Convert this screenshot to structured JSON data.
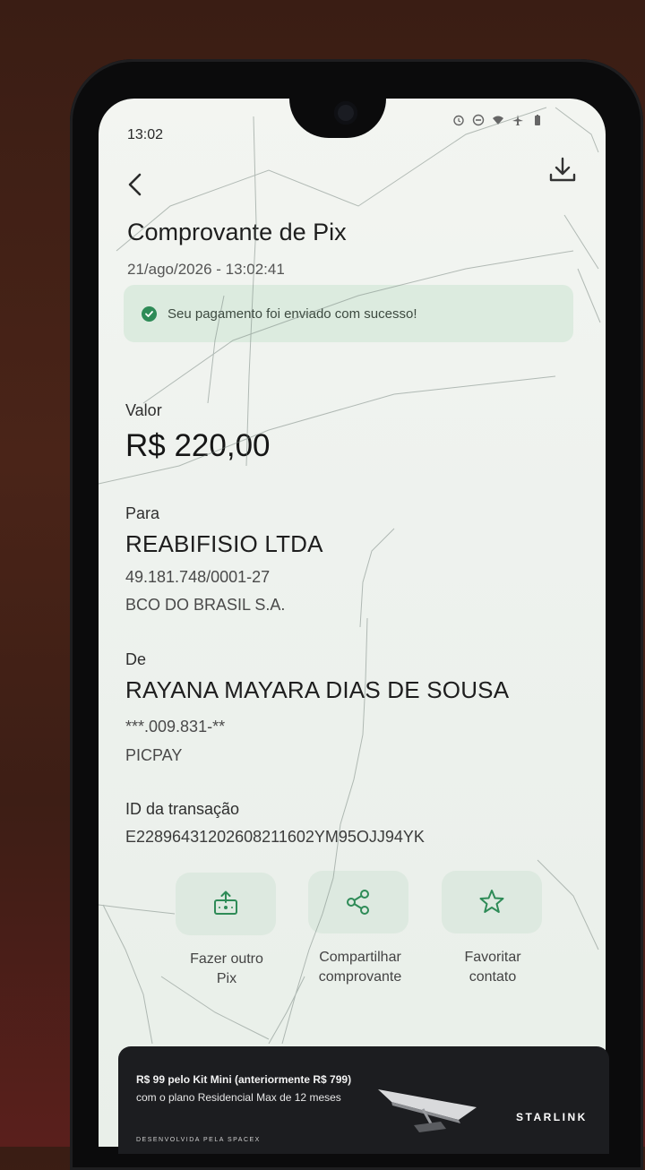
{
  "status_bar": {
    "time": "13:02"
  },
  "header": {
    "title": "Comprovante de Pix",
    "datetime": "21/ago/2026 - 13:02:41"
  },
  "banner": {
    "text": "Seu pagamento foi enviado com sucesso!"
  },
  "amount": {
    "label": "Valor",
    "value": "R$ 220,00"
  },
  "recipient": {
    "label": "Para",
    "name": "REABIFISIO LTDA",
    "document": "49.181.748/0001-27",
    "bank": "BCO DO BRASIL S.A."
  },
  "sender": {
    "label": "De",
    "name": "RAYANA MAYARA DIAS DE SOUSA",
    "document": "***.009.831-**",
    "bank": "PICPAY"
  },
  "transaction": {
    "label": "ID da transação",
    "id": "E22896431202608211602YM95OJJ94YK"
  },
  "actions": [
    {
      "line1": "Fazer outro",
      "line2": "Pix",
      "icon": "pix-transfer-icon"
    },
    {
      "line1": "Compartilhar",
      "line2": "comprovante",
      "icon": "share-icon"
    },
    {
      "line1": "Favoritar",
      "line2": "contato",
      "icon": "star-icon"
    }
  ],
  "ad": {
    "line1": "R$ 99 pelo Kit Mini (anteriormente R$ 799)",
    "line2": "com o plano Residencial Max de 12 meses",
    "brand": "STARLINK",
    "footer": "DESENVOLVIDA PELA SPACEX"
  },
  "colors": {
    "accent": "#2e8b57",
    "banner_bg": "#dcebdf",
    "button_bg": "#dde9e0"
  }
}
